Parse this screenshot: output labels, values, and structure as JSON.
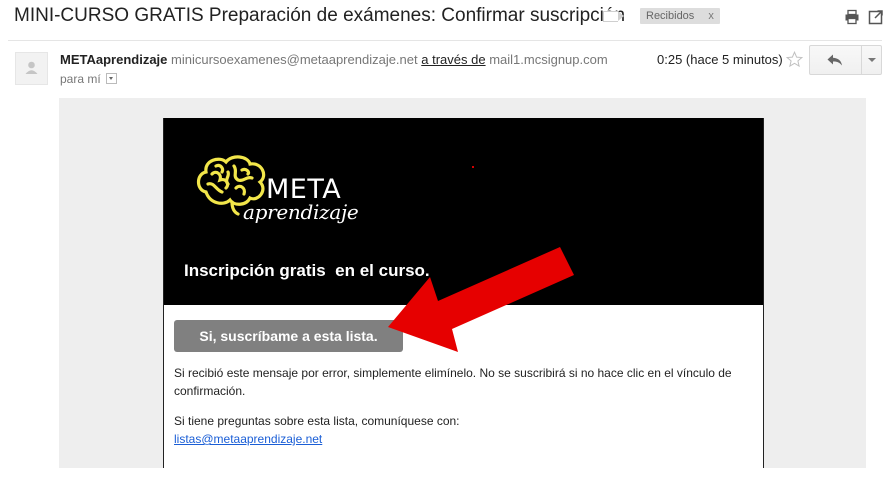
{
  "subject": "MINI-CURSO GRATIS Preparación de exámenes: Confirmar suscripción",
  "label": {
    "name": "Recibidos",
    "remove": "x"
  },
  "icons": {
    "print": "print-icon",
    "new_window": "new-window-icon",
    "star": "star-icon",
    "reply": "reply-icon",
    "more": "chevron-down-icon",
    "avatar": "default-avatar-icon",
    "brain": "brain-logo-icon",
    "arrow": "red-arrow-icon"
  },
  "sender": {
    "name": "METAaprendizaje",
    "email": "minicursoexamenes@metaaprendizaje.net",
    "via_label": "a través de",
    "via_domain": "mail1.mcsignup.com"
  },
  "recipient": "para mí",
  "timestamp": "0:25 (hace 5 minutos)",
  "email": {
    "logo_word_top": "META",
    "logo_word_bottom": "aprendizaje",
    "headline": "Inscripción gratis  en el curso.",
    "button_label": "Si, suscríbame a esta lista.",
    "disclaimer": "Si recibió este mensaje por error, simplemente elimínelo. No se suscribirá si no hace clic en el vínculo de confirmación.",
    "contact_text": "Si tiene preguntas sobre esta lista, comuníquese con:",
    "contact_email": "listas@metaaprendizaje.net"
  },
  "colors": {
    "header_bg": "#000000",
    "button_bg": "#808080",
    "body_bg": "#eeeeee",
    "link": "#1a5ed6",
    "logo_yellow": "#f2e64a",
    "arrow_red": "#e60000"
  }
}
